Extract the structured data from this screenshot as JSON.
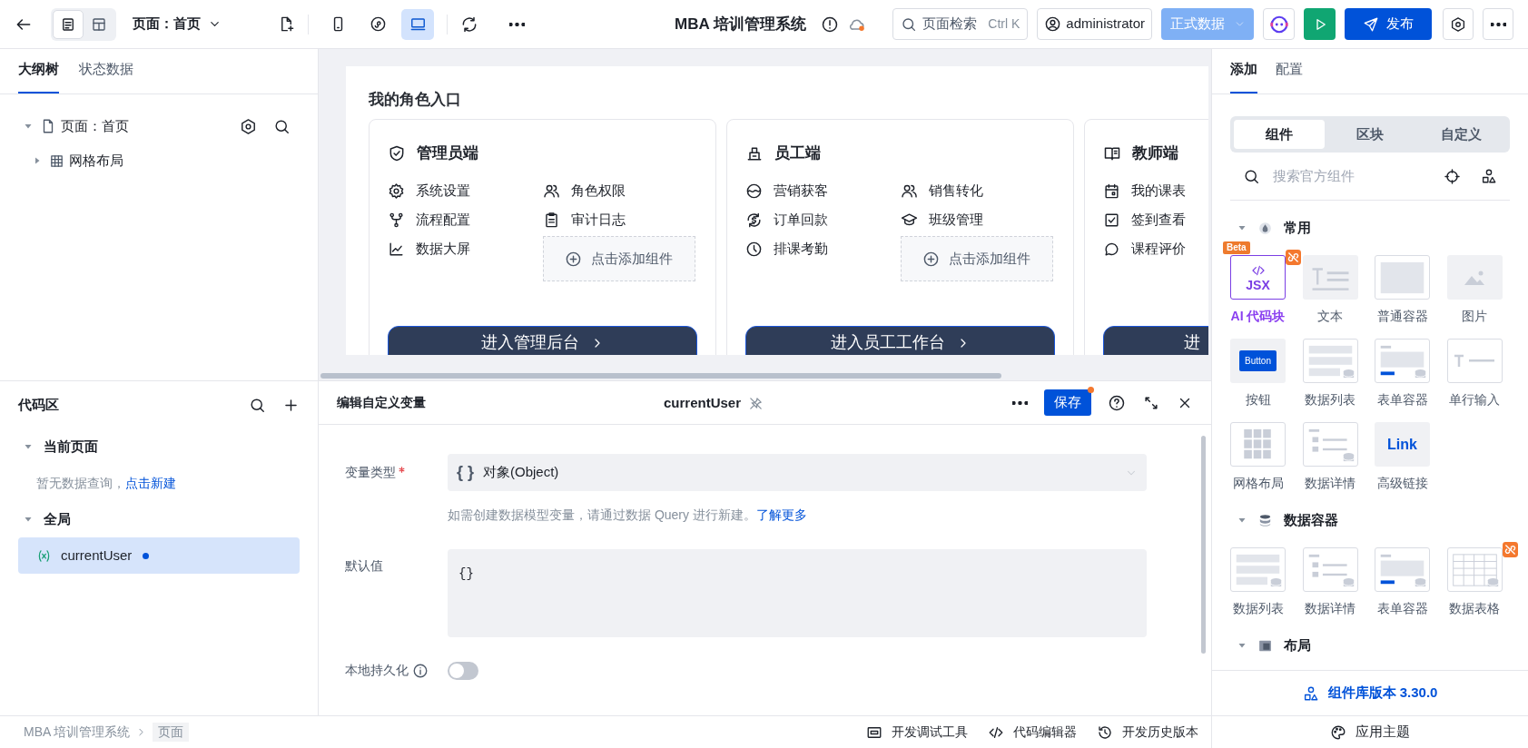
{
  "top_bar": {
    "view_toggle": [
      {
        "selected": true
      },
      {
        "selected": false
      }
    ],
    "page_selector": "页面：首页",
    "devices": [
      {
        "selected": false
      },
      {
        "selected": false
      },
      {
        "selected": true
      }
    ],
    "app_title": "MBA 培训管理系统",
    "search": {
      "placeholder": "页面检索",
      "shortcut": "Ctrl K"
    },
    "user": "administrator",
    "environment": "正式数据",
    "publish": "发布"
  },
  "outline_panel": {
    "tabs": [
      {
        "label": "大纲树",
        "selected": true
      },
      {
        "label": "状态数据",
        "selected": false
      }
    ],
    "tree": [
      {
        "label": "页面：首页",
        "expanded": true,
        "children": [
          {
            "label": "网格布局",
            "expanded": false
          }
        ]
      }
    ]
  },
  "canvas": {
    "title": "我的角色入口",
    "cards": [
      {
        "title": "管理员端",
        "columns": [
          [
            "系统设置",
            "流程配置",
            "数据大屏"
          ],
          [
            "角色权限",
            "审计日志"
          ]
        ],
        "add_label": "点击添加组件",
        "button": "进入管理后台"
      },
      {
        "title": "员工端",
        "columns": [
          [
            "营销获客",
            "订单回款",
            "排课考勤"
          ],
          [
            "销售转化",
            "班级管理"
          ]
        ],
        "add_label": "点击添加组件",
        "button": "进入员工工作台"
      },
      {
        "title": "教师端",
        "columns": [
          [
            "我的课表",
            "签到查看",
            "课程评价"
          ]
        ],
        "button": "进"
      }
    ]
  },
  "code_panel": {
    "title": "代码区",
    "sections": [
      {
        "title": "当前页面",
        "expanded": true,
        "empty_text": "暂无数据查询，",
        "empty_link": "点击新建"
      },
      {
        "title": "全局",
        "expanded": true,
        "items": [
          {
            "name": "currentUser",
            "selected": true,
            "modified": true
          }
        ]
      }
    ]
  },
  "editor": {
    "title": "编辑自定义变量",
    "variable": "currentUser",
    "save": "保存",
    "unsaved": true,
    "fields": [
      {
        "kind": "select",
        "label": "变量类型",
        "required": true,
        "type_icon": "{ }",
        "value": "对象(Object)",
        "hint": "如需创建数据模型变量，请通过数据 Query 进行新建。",
        "hint_link": "了解更多"
      },
      {
        "kind": "code",
        "label": "默认值",
        "value": "{}"
      },
      {
        "kind": "toggle",
        "label": "本地持久化",
        "on": false
      }
    ]
  },
  "component_panel": {
    "tabs": [
      {
        "label": "添加",
        "selected": true
      },
      {
        "label": "配置",
        "selected": false
      }
    ],
    "segments": [
      {
        "label": "组件",
        "selected": true
      },
      {
        "label": "区块",
        "selected": false
      },
      {
        "label": "自定义",
        "selected": false
      }
    ],
    "search": {
      "placeholder": "搜索官方组件"
    },
    "groups": [
      {
        "title": "常用",
        "expanded": true,
        "items": [
          {
            "label": "AI 代码块",
            "kind": "jsx",
            "preview_text": "JSX",
            "badge": "Beta",
            "marked": true
          },
          {
            "label": "文本",
            "kind": "text",
            "marked": false
          },
          {
            "label": "普通容器",
            "kind": "container",
            "marked": false
          },
          {
            "label": "图片",
            "kind": "image",
            "marked": false
          },
          {
            "label": "按钮",
            "kind": "button",
            "preview_text": "Button",
            "marked": false
          },
          {
            "label": "数据列表",
            "kind": "list",
            "marked": false
          },
          {
            "label": "表单容器",
            "kind": "form",
            "marked": false
          },
          {
            "label": "单行输入",
            "kind": "input",
            "marked": false
          },
          {
            "label": "网格布局",
            "kind": "grid",
            "marked": false
          },
          {
            "label": "数据详情",
            "kind": "detail",
            "marked": false
          },
          {
            "label": "高级链接",
            "kind": "link",
            "preview_text": "Link",
            "marked": false
          }
        ]
      },
      {
        "title": "数据容器",
        "expanded": true,
        "items": [
          {
            "label": "数据列表",
            "kind": "list",
            "marked": false
          },
          {
            "label": "数据详情",
            "kind": "detail",
            "marked": false
          },
          {
            "label": "表单容器",
            "kind": "form",
            "marked": false
          },
          {
            "label": "数据表格",
            "kind": "table",
            "marked": true
          }
        ]
      },
      {
        "title": "布局",
        "expanded": true
      }
    ],
    "library_version": "组件库版本 3.30.0"
  },
  "status_bar": {
    "breadcrumb": [
      "MBA 培训管理系统",
      "页面"
    ],
    "tools": [
      "开发调试工具",
      "代码编辑器",
      "开发历史版本"
    ],
    "theme": "应用主题"
  }
}
